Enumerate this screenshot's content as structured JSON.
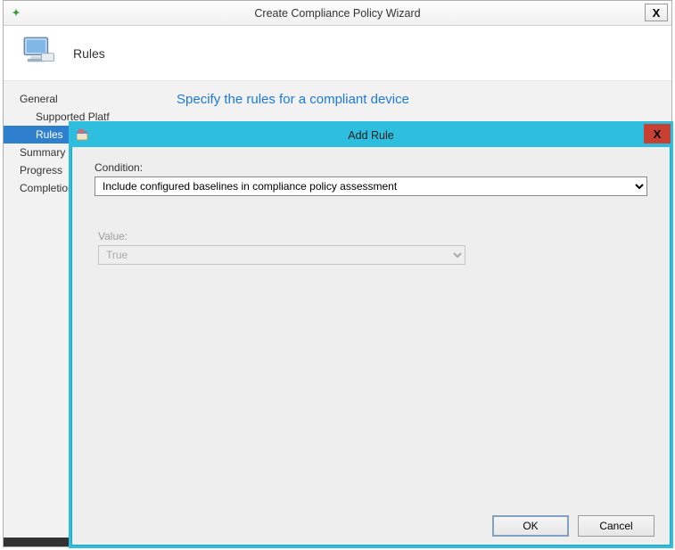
{
  "wizard": {
    "title": "Create Compliance Policy Wizard",
    "close_x": "X",
    "header_page_title": "Rules",
    "nav": {
      "general": "General",
      "supported_platforms": "Supported Platf",
      "rules": "Rules",
      "summary": "Summary",
      "progress": "Progress",
      "completion": "Completion"
    },
    "instruction": "Specify the rules for a compliant device"
  },
  "dialog": {
    "title": "Add Rule",
    "close_x": "X",
    "condition_label": "Condition:",
    "condition_value": "Include configured baselines in compliance policy assessment",
    "value_label": "Value:",
    "value_value": "True",
    "ok_label": "OK",
    "cancel_label": "Cancel"
  }
}
